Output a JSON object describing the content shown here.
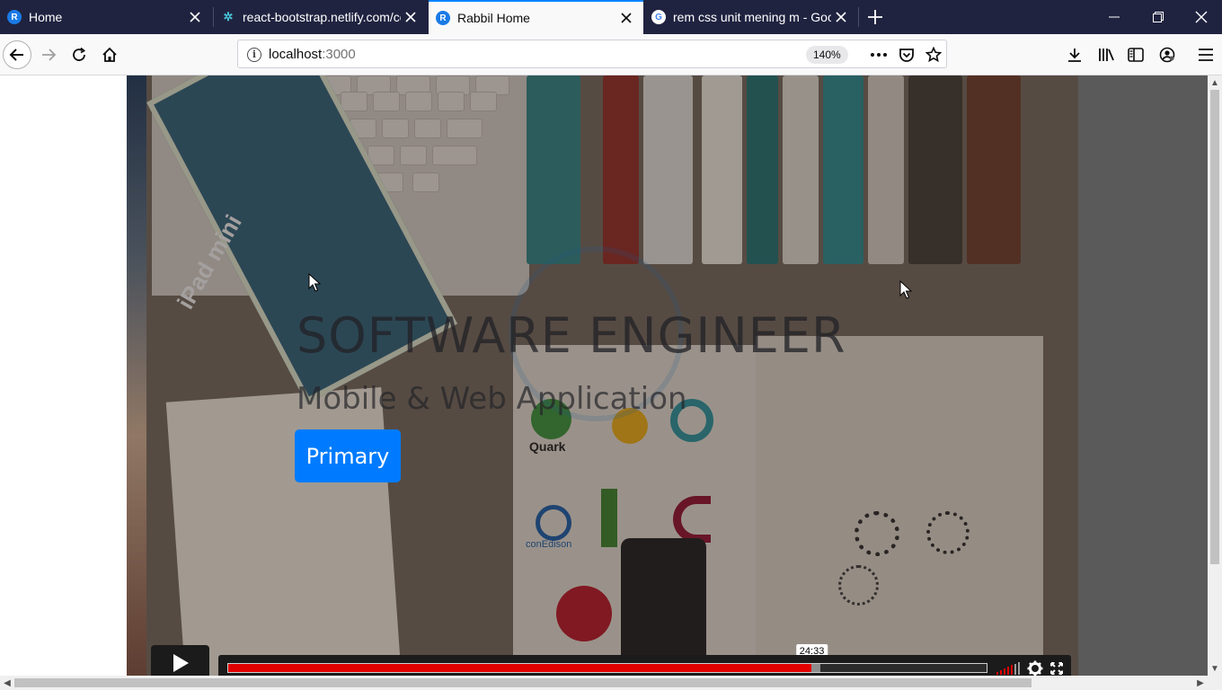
{
  "browser": {
    "tabs": [
      {
        "title": "Home",
        "favicon": "react-logo-icon",
        "active": false
      },
      {
        "title": "react-bootstrap.netlify.com/co",
        "favicon": "react-bootstrap-icon",
        "active": false
      },
      {
        "title": "Rabbil Home",
        "favicon": "react-logo-icon",
        "active": true
      },
      {
        "title": "rem css unit mening m - Googl",
        "favicon": "google-icon",
        "active": false
      }
    ],
    "url_host": "localhost",
    "url_port": ":3000",
    "zoom_level": "140%"
  },
  "page": {
    "hero_title": "SOFTWARE ENGINEER",
    "hero_subtitle": "Mobile & Web Application",
    "primary_button_label": "Primary",
    "background_text": {
      "ipad": "iPad mini",
      "quark": "Quark",
      "conedison": "conEdison"
    }
  },
  "video": {
    "time_tooltip": "24:33",
    "progress_fraction": 0.769,
    "buffered_fraction": 0.781
  },
  "colors": {
    "tabbar_bg": "#202340",
    "active_tab_accent": "#0a84ff",
    "primary_button": "#007bff",
    "progress_red": "#e00000"
  }
}
